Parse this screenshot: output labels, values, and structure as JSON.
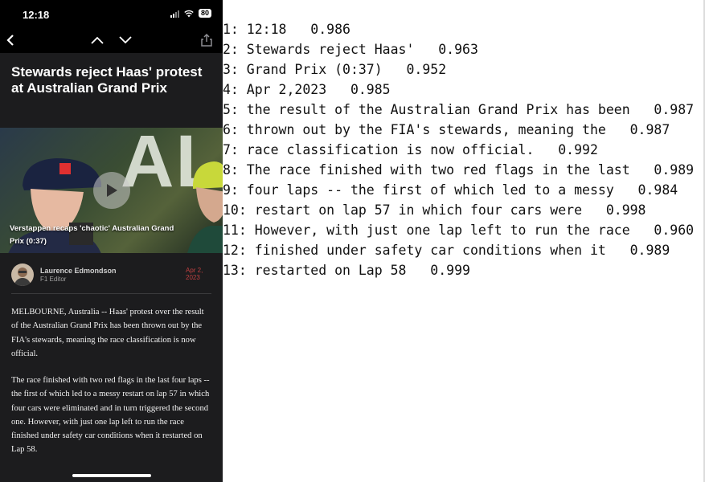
{
  "status_bar": {
    "time": "12:18",
    "battery": "80"
  },
  "article": {
    "headline": "Stewards reject Haas' protest at Australian Grand Prix",
    "video_caption": "Verstappen recaps 'chaotic' Australian Grand Prix (0:37)",
    "author_name": "Laurence Edmondson",
    "author_role": "F1 Editor",
    "date": "Apr 2, 2023",
    "paragraph1": "MELBOURNE, Australia -- Haas' protest over the result of the Australian Grand Prix has been thrown out by the FIA's stewards, meaning the race classification is now official.",
    "paragraph2": "The race finished with two red flags in the last four laps -- the first of which led to a messy restart on lap 57 in which four cars were eliminated and in turn triggered the second one. However, with just one lap left to run the race finished under safety car conditions when it restarted on Lap 58."
  },
  "ocr_results": [
    "1: 12:18   0.986",
    "2: Stewards reject Haas'   0.963",
    "3: Grand Prix (0:37)   0.952",
    "4: Apr 2,2023   0.985",
    "5: the result of the Australian Grand Prix has been   0.987",
    "6: thrown out by the FIA's stewards, meaning the   0.987",
    "7: race classification is now official.   0.992",
    "8: The race finished with two red flags in the last   0.989",
    "9: four laps -- the first of which led to a messy   0.984",
    "10: restart on lap 57 in which four cars were   0.998",
    "11: However, with just one lap left to run the race   0.960",
    "12: finished under safety car conditions when it   0.989",
    "13: restarted on Lap 58   0.999"
  ]
}
